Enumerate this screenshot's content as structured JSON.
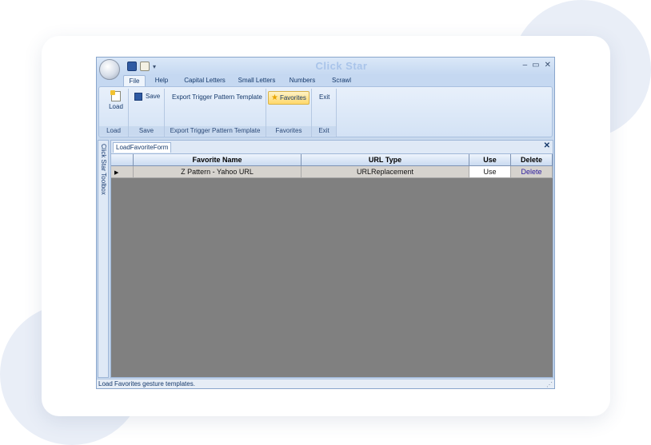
{
  "app": {
    "title": "Click Star",
    "qat_arrow": "▾",
    "window_buttons": {
      "minimize": "–",
      "maximize": "▭",
      "close": "✕"
    }
  },
  "tabs": [
    {
      "label": "File",
      "active": true
    },
    {
      "label": "Help"
    },
    {
      "label": "Capital Letters"
    },
    {
      "label": "Small Letters"
    },
    {
      "label": "Numbers"
    },
    {
      "label": "Scrawl"
    }
  ],
  "ribbon": {
    "load": {
      "button": "Load",
      "group": "Load"
    },
    "save": {
      "button": "Save",
      "group": "Save"
    },
    "export": {
      "button": "Export Trigger Pattern Template",
      "group": "Export Trigger Pattern Template"
    },
    "favorites": {
      "button": "Favorites",
      "group": "Favorites"
    },
    "exit": {
      "button": "Exit",
      "group": "Exit"
    }
  },
  "sidebar": {
    "label": "Click Star Toolbox"
  },
  "document": {
    "tab": "LoadFavoriteForm",
    "close": "✕",
    "grid": {
      "columns": [
        "Favorite Name",
        "URL Type",
        "Use",
        "Delete"
      ],
      "rows": [
        {
          "indicator": "▶",
          "name": "Z Pattern - Yahoo URL",
          "url_type": "URLReplacement",
          "use": "Use",
          "delete": "Delete"
        }
      ]
    }
  },
  "status": {
    "text": "Load Favorites gesture templates.",
    "grip": "⋰"
  },
  "icons": [
    "orb-icon",
    "save-icon",
    "document-icon",
    "load-icon",
    "star-icon",
    "close-icon",
    "row-pointer-icon",
    "resize-grip-icon"
  ],
  "colors": {
    "accent": "#c8d9ee",
    "title_text": "#a9c4ea",
    "grid_background": "#808080",
    "link": "#2b1b9e"
  }
}
